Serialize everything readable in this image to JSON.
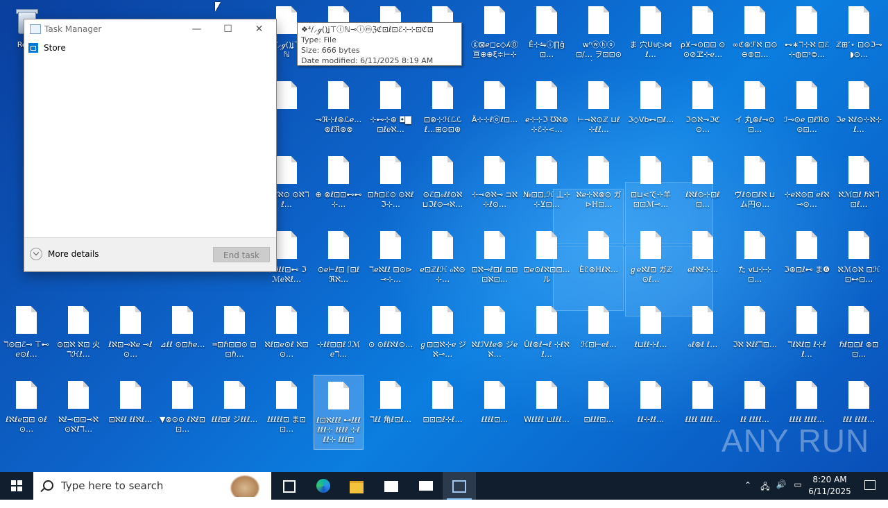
{
  "desktop": {
    "recycle_bin_label": "Recy",
    "icons": [
      {
        "label": "❖⁴/⸝ℊ()ʝ⊤ⓘℕ",
        "col": 5,
        "row": 0
      },
      {
        "label": "",
        "col": 6,
        "row": 0
      },
      {
        "label": "",
        "col": 7,
        "row": 0
      },
      {
        "label": "",
        "col": 8,
        "row": 0
      },
      {
        "label": "ⓖ⊠ℯ◻ɕ◇ʎ⓪ 亘⊕⊕ξ≑⊢⊹ዮ…",
        "col": 9,
        "row": 0
      },
      {
        "label": "Ê⊹⇋ⓘ∏ĝ⊡… ",
        "col": 10,
        "row": 0
      },
      {
        "label": "wⁿⓦⓗⓞ⊡/… ヲ⊡⊡⊙言⊙…",
        "col": 11,
        "row": 0
      },
      {
        "label": "ま 穴U⊎▷⋈ℓ…",
        "col": 12,
        "row": 0
      },
      {
        "label": "ρ⊻⊸⊙⊡⊡ ⊙⊙⊘ヱ⊹ℯ…",
        "col": 13,
        "row": 0
      },
      {
        "label": "∞ℭ⊛ℱℵ ⊡⊙⊖⊚⊡…",
        "col": 14,
        "row": 0
      },
      {
        "label": "⊷∗ℸ⊹ℵ ⊡ℰ⊹◍⊡ˢ⊜…",
        "col": 15,
        "row": 0
      },
      {
        "label": "ℤ⊞ʼ⋆ ⊡⊙ℑ⊸◗⊙…",
        "col": 16,
        "row": 0
      },
      {
        "label": "",
        "col": 5,
        "row": 1
      },
      {
        "label": "⊸ℜ⊹ℓ⊛ℒℯ…⊛ℓℜ⊛⊗",
        "col": 6,
        "row": 1
      },
      {
        "label": "⊹⊷⊹⊛ ◘▇⊡ℓℯℵ…",
        "col": 7,
        "row": 1
      },
      {
        "label": "⊡⊗⊹ℋℒℒℓ…⊞⊙⊡⊛◬…",
        "col": 8,
        "row": 1
      },
      {
        "label": "Ä⊹⊹ℓⓞℓ⊡…",
        "col": 9,
        "row": 1
      },
      {
        "label": "ℯ⊹⊹ℑ ℧ℵ⊛⊹ℰ⊹<…",
        "col": 10,
        "row": 1
      },
      {
        "label": "⊢⊸ℵ⊙ℤ ⊔ℓ⊹ℓℓ…",
        "col": 11,
        "row": 1
      },
      {
        "label": "ℑ◇Ⅴb⊷⊡ℓ…",
        "col": 12,
        "row": 1
      },
      {
        "label": "ℑ⊙ℵ⊸ℑℭ⊙…",
        "col": 13,
        "row": 1
      },
      {
        "label": "イ 丸⊛ℓ⊸⊙⊡…",
        "col": 14,
        "row": 1
      },
      {
        "label": "ℐ⊸⊙ℯ ⊡ℓℜ⊙⊙⊡…",
        "col": 15,
        "row": 1
      },
      {
        "label": "ℑℯ ℵℓ⊙⊹ℵ⊹ℓ…",
        "col": 16,
        "row": 1
      },
      {
        "label": "ℑℵℓℵ⊙ ⊙ℵℸℓ…",
        "col": 5,
        "row": 2
      },
      {
        "label": "⊕ ⊗ℓ⊡⊡⊷⊷⊹…",
        "col": 6,
        "row": 2
      },
      {
        "label": "⊡ℏ⊡ℰ⊙ ⊙ℵℓℑ⊹…",
        "col": 7,
        "row": 2
      },
      {
        "label": "⊙ℰ⊡ℴℓℓ⊙ℵ ⊔ℑℓ⊙⊸ℵ…",
        "col": 8,
        "row": 2
      },
      {
        "label": "⊹⊸⊘ℵ⊸ ⊐ℵ⊹ℓ⊙…",
        "col": 9,
        "row": 2
      },
      {
        "label": "№⊡⊡,ℋ 丄⊹⊹⊻⊡…",
        "col": 10,
        "row": 2
      },
      {
        "label": "ℵℯ⊹ℵ⊗⊙ ガ⊳ℍ⊡…",
        "col": 11,
        "row": 2
      },
      {
        "label": "⊡⊔<で⊹羊 ⊡⊡ℳ⊸…",
        "col": 12,
        "row": 2
      },
      {
        "label": "ℓℵℓ⊙⊹⊡ℓ⊡…",
        "col": 13,
        "row": 2
      },
      {
        "label": "ヴℓ⊙⊡ℓℵ ⊔ム円⊙…",
        "col": 14,
        "row": 2
      },
      {
        "label": "⊹ℯℵ⊙⊡ ℯℓℵ⊸⊙…",
        "col": 15,
        "row": 2
      },
      {
        "label": "ℵℳ⊡ℓ ℏℵℸ⊡ℓ…",
        "col": 16,
        "row": 2
      },
      {
        "label": "⊹ℑℓℓ⊡⊷ ℑℳℯℵℓ…",
        "col": 5,
        "row": 3
      },
      {
        "label": "⊙ℯ⊢ℓ⊡ ⌈⊡ℓℜℵ…",
        "col": 6,
        "row": 3
      },
      {
        "label": "ℸℯℵℓℓ ⊡⊙⊳⊸⊹…",
        "col": 7,
        "row": 3
      },
      {
        "label": "ℯ⊡ℤℓℋ ℴℵ⊙⊹…",
        "col": 8,
        "row": 3
      },
      {
        "label": "⊡ℵ⊸ℓ⊡ℓ ⊡⊡⊡ℵ⊡…",
        "col": 9,
        "row": 3
      },
      {
        "label": "⊡ℯ⊙ℓℵ⊡⊡… ル",
        "col": 10,
        "row": 3
      },
      {
        "label": "Èℰ⊛ℍℓℵ…",
        "col": 11,
        "row": 3
      },
      {
        "label": "ℊℯℵℓ⊡ ガℤ⊙ℓ…",
        "col": 12,
        "row": 3
      },
      {
        "label": "ℯℓℵℓ⊹…",
        "col": 13,
        "row": 3
      },
      {
        "label": "た ⅴ⊔⊹⊹⊡…",
        "col": 14,
        "row": 3
      },
      {
        "label": "ℑ⊛⊡ℓ⊷ ま❻",
        "col": 15,
        "row": 3
      },
      {
        "label": "ℵℳ⊙ℵ ⊡ℋ⊡⊷⊡…",
        "col": 16,
        "row": 3
      },
      {
        "label": "ℸ⊙⊡ℰ⊸ ⊤⊷ℯ⊙ℓ…",
        "col": 0,
        "row": 4
      },
      {
        "label": "⊙⊡ℵ ℵ⊡ 火 ℸℋℓ…",
        "col": 1,
        "row": 4
      },
      {
        "label": "ℓℵ⊡⊸ℵℯ ⊸ℓ⊙…",
        "col": 2,
        "row": 4
      },
      {
        "label": "⊿ℓℓ ⊙⊡ℏℯ…",
        "col": 3,
        "row": 4
      },
      {
        "label": "═⊡ℏ⊡⊡⊙ ⊡⊡ℏ…",
        "col": 4,
        "row": 4
      },
      {
        "label": "ℵℓ⊡ℯ⊙ℓ ℵ⊡⊙…",
        "col": 5,
        "row": 4
      },
      {
        "label": "⊹ℓℓ⊡⊡ℓ ℐℳℯℸ…",
        "col": 6,
        "row": 4
      },
      {
        "label": "⊙ ⊙ℓℓℵℓ⊙…",
        "col": 7,
        "row": 4
      },
      {
        "label": "ℊ⊡⊡ℵ⊹ℯ ジℵ⊸…",
        "col": 8,
        "row": 4
      },
      {
        "label": "ℵℓℐⅤℓℯ⊛ ジℯℵ…",
        "col": 9,
        "row": 4
      },
      {
        "label": "Ûℓ⊛ℓ⊸ℓ ⊹ℓℵℓ…",
        "col": 10,
        "row": 4
      },
      {
        "label": "ℋ⊡⊢ℯℓ…",
        "col": 11,
        "row": 4
      },
      {
        "label": "ℓ⊔ℓℓ⊹ℓ…",
        "col": 12,
        "row": 4
      },
      {
        "label": "ℴℓ⊛ℓ ℓ…",
        "col": 13,
        "row": 4
      },
      {
        "label": "ℑℵ ℵℓℓℸ⊡…",
        "col": 14,
        "row": 4
      },
      {
        "label": "ℸℓℵℓ⊡ ℓ⊹ℓℓ…",
        "col": 15,
        "row": 4
      },
      {
        "label": "ℏℓ⊡⊡ℓ ⊛⊡⊡…",
        "col": 16,
        "row": 4
      },
      {
        "label": "ℓℵℓℯ⊡⊡ ⊙ℓ⊙…",
        "col": 0,
        "row": 5
      },
      {
        "label": "ℵℓ⊸⊡⊡⊸ℵ ⊙ℵℓℸ…",
        "col": 1,
        "row": 5
      },
      {
        "label": "⊡ℵℓℓ ℓℓℵℓ…",
        "col": 2,
        "row": 5
      },
      {
        "label": "▼⊗⊙⊙ ℓℵℓ⊡⊡…",
        "col": 3,
        "row": 5
      },
      {
        "label": "ℓℓℓ⊡ℓ ジℓℓℓ…",
        "col": 4,
        "row": 5
      },
      {
        "label": "ℓℓℓℓℓ⊡ ま⊡⊡…",
        "col": 5,
        "row": 5
      },
      {
        "label": "ℓ⊡ℵℓℓℓ ⊷ℓℓℓ ℓℓℓ⊹ ℓℓℓℓ ⊹ℓℓℓ⊹ ℓℓℓ⊡",
        "col": 6,
        "row": 5,
        "selected": true
      },
      {
        "label": "ℸℓℓ 角ℓ⊡ℓ…",
        "col": 7,
        "row": 5
      },
      {
        "label": "⊡⊡⊡ℓ⊹ℓ…",
        "col": 8,
        "row": 5
      },
      {
        "label": "ℓℓℓℓ⊡…",
        "col": 9,
        "row": 5
      },
      {
        "label": "Wℓℓℓℓ ⊔ℓℓℓ…",
        "col": 10,
        "row": 5
      },
      {
        "label": "⊡ℓℓℓ⊡…",
        "col": 11,
        "row": 5
      },
      {
        "label": "ℓℓ⊹ℓℓ…",
        "col": 12,
        "row": 5
      },
      {
        "label": "ℓℓℓℓ ℓℓℓℓ…",
        "col": 13,
        "row": 5
      },
      {
        "label": "ℓℓ ℓℓℓℓ…",
        "col": 14,
        "row": 5
      },
      {
        "label": "ℓℓℓℓ ℓℓℓℓ…",
        "col": 15,
        "row": 5
      },
      {
        "label": "ℓℓℓ ℓℓℓℓ…",
        "col": 16,
        "row": 5
      }
    ]
  },
  "tooltip": {
    "title": "❖⁴/⸝ℊ()ʝ⊤ⓘℕ⊸ⓘⓜℨℭ⊡ℓ⊡ℰ⊹⊹⊡ℭ⊡",
    "type": "Type: File",
    "size": "Size: 666 bytes",
    "modified": "Date modified: 6/11/2025 8:19 AM"
  },
  "task_manager": {
    "title": "Task Manager",
    "minimize": "—",
    "maximize": "☐",
    "close": "✕",
    "app_item": "Store",
    "more_details": "More details",
    "end_task": "End task"
  },
  "watermark": "ANY RUN",
  "taskbar": {
    "search_placeholder": "Type here to search",
    "time": "8:20 AM",
    "date": "6/11/2025",
    "icons": [
      "task-view-icon",
      "edge-icon",
      "file-explorer-icon",
      "store-icon",
      "mail-icon",
      "task-manager-icon"
    ]
  }
}
